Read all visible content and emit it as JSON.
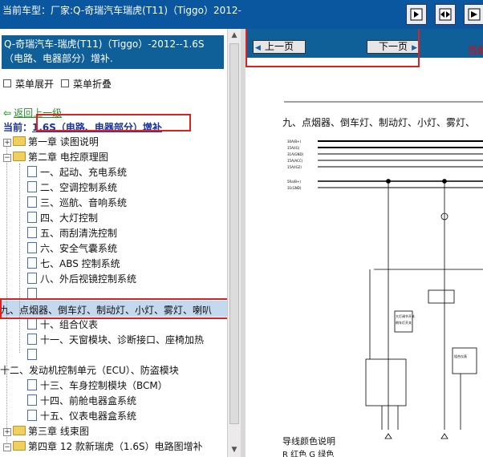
{
  "titlebar": {
    "title": "当前车型：厂家:Q-奇瑞汽车瑞虎(T11)（Tiggo）2012-"
  },
  "toolbar": {
    "btn1_icon": "panel-right-icon",
    "btn2_icon": "expand-horizontal-icon",
    "btn3_icon": "arrow-right-icon"
  },
  "left": {
    "book_title": "Q-奇瑞汽车-瑞虎(T11)（Tiggo）-2012--1.6S（电路、电器部分）增补.",
    "menu_expand": "菜单展开",
    "menu_collapse": "菜单折叠",
    "back": "返回上一级",
    "current_prefix": "当前：",
    "current_value": "1.6S（电路、电器部分）增补",
    "tree": [
      {
        "label": "第一章 读图说明",
        "type": "folder",
        "level": 0
      },
      {
        "label": "第二章 电控原理图",
        "type": "folder",
        "level": 0
      },
      {
        "label": "一、起动、充电系统",
        "type": "doc",
        "level": 1
      },
      {
        "label": "二、空调控制系统",
        "type": "doc",
        "level": 1
      },
      {
        "label": "三、巡航、音响系统",
        "type": "doc",
        "level": 1
      },
      {
        "label": "四、大灯控制",
        "type": "doc",
        "level": 1
      },
      {
        "label": "五、雨刮清洗控制",
        "type": "doc",
        "level": 1
      },
      {
        "label": "六、安全气囊系统",
        "type": "doc",
        "level": 1
      },
      {
        "label": "七、ABS 控制系统",
        "type": "doc",
        "level": 1
      },
      {
        "label": "八、外后视镜控制系统",
        "type": "doc",
        "level": 1
      },
      {
        "label": "",
        "type": "doc",
        "level": 1
      },
      {
        "label": "九、点烟器、倒车灯、制动灯、小灯、雾灯、喇叭",
        "type": "selected",
        "level": 0
      },
      {
        "label": "十、组合仪表",
        "type": "doc",
        "level": 1
      },
      {
        "label": "十一、天窗模块、诊断接口、座椅加热",
        "type": "doc",
        "level": 1
      },
      {
        "label": "",
        "type": "doc",
        "level": 1
      },
      {
        "label": "十二、发动机控制单元（ECU）、防盗模块",
        "type": "plain",
        "level": 0
      },
      {
        "label": "十三、车身控制模块（BCM）",
        "type": "doc",
        "level": 1
      },
      {
        "label": "十四、前舱电器盒系统",
        "type": "doc",
        "level": 1
      },
      {
        "label": "十五、仪表电器盒系统",
        "type": "doc",
        "level": 1
      },
      {
        "label": "第三章 线束图",
        "type": "folder",
        "level": 0
      },
      {
        "label": "第四章 12 款新瑞虎（1.6S）电路图增补",
        "type": "folder",
        "level": 0
      }
    ]
  },
  "right": {
    "prev": "上一页",
    "next": "下一页",
    "current_page": "当前",
    "doc_heading": "九、点烟器、倒车灯、制动灯、小灯、雾灯、",
    "legend_title": "导线颜色说明",
    "legend_line": "R 红色    G 绿色",
    "diagram_wire_labels": [
      "30A(B+)",
      "15A(IG)",
      "31A(GND)",
      "15A(ACC)",
      "15A(IG2)",
      "5Ra(B+)",
      "31(GND)"
    ],
    "diagram_box_labels": [
      "大灯调节开关",
      "倒车灯开关",
      "组合仪表"
    ]
  }
}
